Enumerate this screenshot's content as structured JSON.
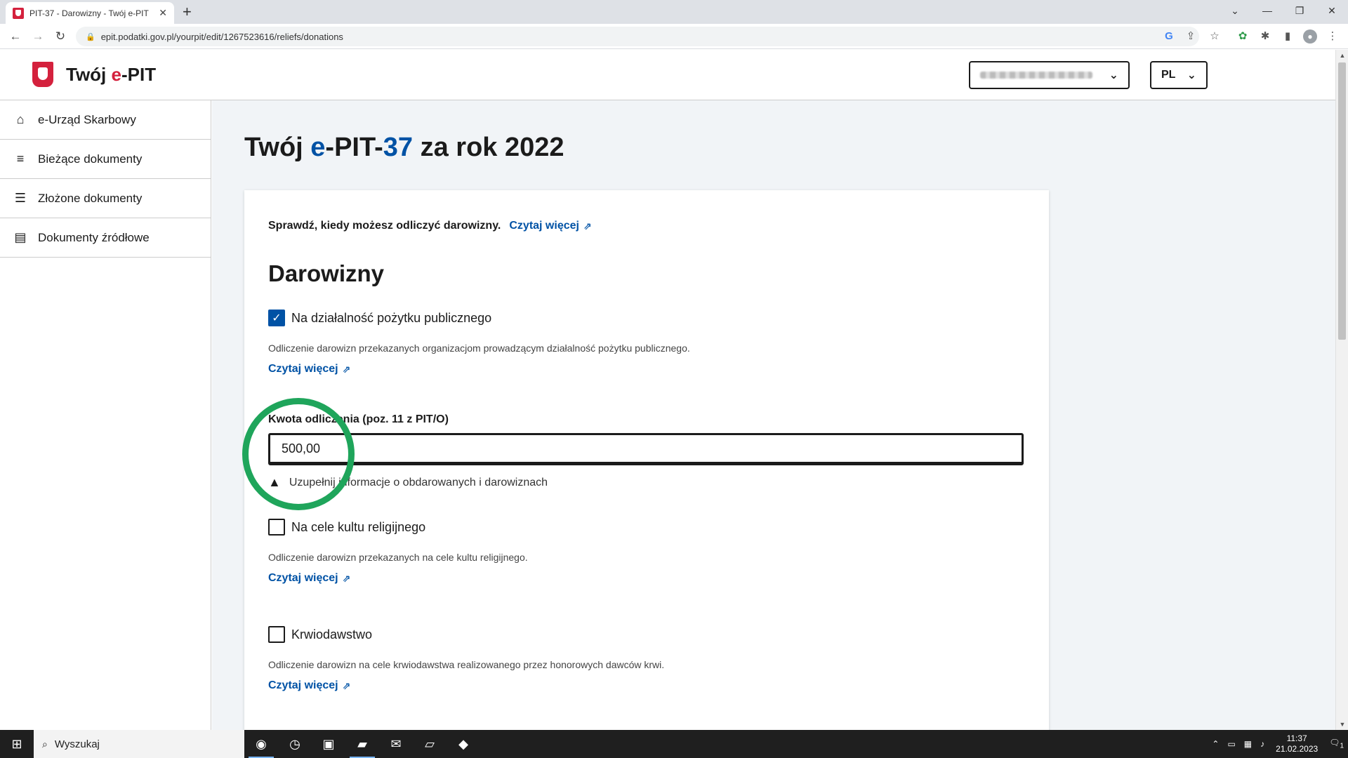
{
  "browser": {
    "tab_title": "PIT-37 - Darowizny - Twój e-PIT",
    "url": "epit.podatki.gov.pl/yourpit/edit/1267523616/reliefs/donations"
  },
  "header": {
    "brand_prefix": "Twój ",
    "brand_accent": "e",
    "brand_suffix": "-PIT",
    "language": "PL"
  },
  "sidebar": {
    "items": [
      {
        "label": "e-Urząd Skarbowy",
        "icon": "home-icon"
      },
      {
        "label": "Bieżące dokumenty",
        "icon": "playlist-add-icon"
      },
      {
        "label": "Złożone dokumenty",
        "icon": "playlist-check-icon"
      },
      {
        "label": "Dokumenty źródłowe",
        "icon": "document-icon"
      }
    ]
  },
  "main": {
    "title_prefix": "Twój ",
    "title_blue1": "e",
    "title_mid": "-PIT-",
    "title_blue2": "37",
    "title_suffix": " za rok 2022",
    "info_text": "Sprawdź, kiedy możesz odliczyć darowizny.",
    "read_more": "Czytaj więcej",
    "section_title": "Darowizny",
    "options": [
      {
        "label": "Na działalność pożytku publicznego",
        "checked": true,
        "desc": "Odliczenie darowizn przekazanych organizacjom prowadzącym działalność pożytku publicznego.",
        "link": "Czytaj więcej"
      },
      {
        "label": "Na cele kultu religijnego",
        "checked": false,
        "desc": "Odliczenie darowizn przekazanych na cele kultu religijnego.",
        "link": "Czytaj więcej"
      },
      {
        "label": "Krwiodawstwo",
        "checked": false,
        "desc": "Odliczenie darowizn na cele krwiodawstwa realizowanego przez honorowych dawców krwi.",
        "link": "Czytaj więcej"
      }
    ],
    "amount_label": "Kwota odliczenia (poz. 11 z PIT/O)",
    "amount_value": "500,00",
    "warning_text": "Uzupełnij informacje o obdarowanych i darowiznach"
  },
  "taskbar": {
    "search_label": "Wyszukaj",
    "time": "11:37",
    "date": "21.02.2023",
    "notification_count": "1"
  },
  "colors": {
    "brand_red": "#d4213d",
    "link_blue": "#0052a5",
    "annotation_green": "#1fa55b"
  }
}
